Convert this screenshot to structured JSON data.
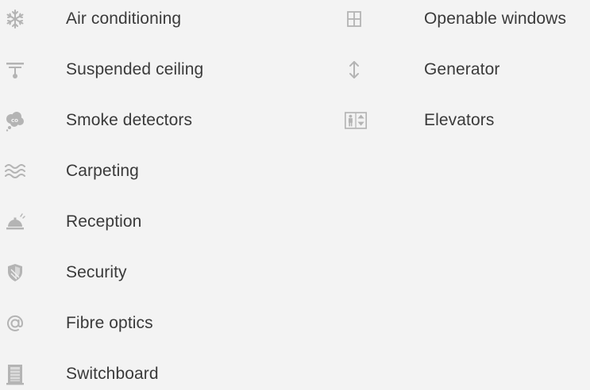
{
  "amenities": {
    "left": [
      {
        "icon": "snowflake-icon",
        "label": "Air conditioning"
      },
      {
        "icon": "suspended-ceiling-icon",
        "label": "Suspended ceiling"
      },
      {
        "icon": "smoke-detector-icon",
        "label": "Smoke detectors"
      },
      {
        "icon": "carpet-waves-icon",
        "label": "Carpeting"
      },
      {
        "icon": "reception-bell-icon",
        "label": "Reception"
      },
      {
        "icon": "shield-icon",
        "label": "Security"
      },
      {
        "icon": "at-sign-icon",
        "label": "Fibre optics"
      },
      {
        "icon": "switchboard-icon",
        "label": "Switchboard"
      }
    ],
    "right": [
      {
        "icon": "window-icon",
        "label": "Openable windows"
      },
      {
        "icon": "vertical-arrows-icon",
        "label": "Generator"
      },
      {
        "icon": "elevator-icon",
        "label": "Elevators"
      }
    ]
  }
}
